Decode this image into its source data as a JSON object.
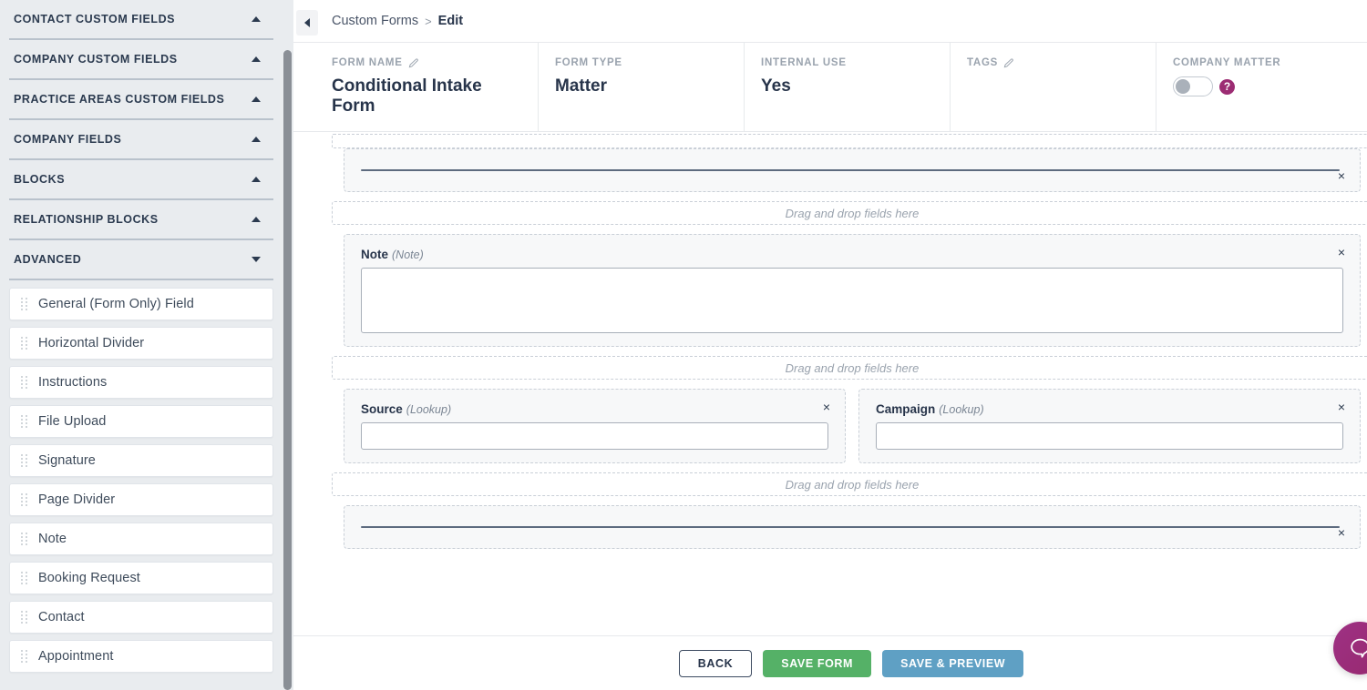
{
  "sidebar": {
    "accordions": [
      {
        "label": "CONTACT CUSTOM FIELDS",
        "state": "up"
      },
      {
        "label": "COMPANY CUSTOM FIELDS",
        "state": "up"
      },
      {
        "label": "PRACTICE AREAS CUSTOM FIELDS",
        "state": "up"
      },
      {
        "label": "COMPANY FIELDS",
        "state": "up"
      },
      {
        "label": "BLOCKS",
        "state": "up"
      },
      {
        "label": "RELATIONSHIP BLOCKS",
        "state": "up"
      },
      {
        "label": "ADVANCED",
        "state": "down"
      }
    ],
    "fields": [
      {
        "label": "General (Form Only) Field"
      },
      {
        "label": "Horizontal Divider"
      },
      {
        "label": "Instructions"
      },
      {
        "label": "File Upload"
      },
      {
        "label": "Signature"
      },
      {
        "label": "Page Divider"
      },
      {
        "label": "Note"
      },
      {
        "label": "Booking Request"
      },
      {
        "label": "Contact"
      },
      {
        "label": "Appointment"
      }
    ]
  },
  "breadcrumb": {
    "parent": "Custom Forms",
    "separator": ">",
    "current": "Edit"
  },
  "meta": {
    "form_name": {
      "label": "FORM NAME",
      "value": "Conditional Intake Form",
      "editable": true
    },
    "form_type": {
      "label": "FORM TYPE",
      "value": "Matter",
      "editable": false
    },
    "internal_use": {
      "label": "INTERNAL USE",
      "value": "Yes",
      "editable": false
    },
    "tags": {
      "label": "TAGS",
      "value": "",
      "editable": true
    },
    "company_matter": {
      "label": "COMPANY MATTER",
      "toggle_on": false,
      "help_glyph": "?"
    }
  },
  "canvas": {
    "dropzone_text": "Drag and drop fields here",
    "close_glyph": "×",
    "rows": [
      {
        "kind": "divider",
        "closable": true
      },
      {
        "kind": "dropzone"
      },
      {
        "kind": "note",
        "label": "Note",
        "type": "(Note)",
        "closable": true
      },
      {
        "kind": "dropzone"
      },
      {
        "kind": "lookup-pair",
        "left": {
          "label": "Source",
          "type": "(Lookup)"
        },
        "right": {
          "label": "Campaign",
          "type": "(Lookup)"
        }
      },
      {
        "kind": "dropzone"
      },
      {
        "kind": "divider",
        "closable": true
      }
    ]
  },
  "footer": {
    "back": "BACK",
    "save": "SAVE FORM",
    "preview": "SAVE & PREVIEW"
  },
  "chat": {
    "icon": "chat-bubble-icon"
  },
  "colors": {
    "sidebar_bg": "#e9ecef",
    "accent_dark": "#27344a",
    "save_green": "#55b167",
    "preview_blue": "#5fa0c4",
    "chat_magenta": "#9c2c73"
  }
}
